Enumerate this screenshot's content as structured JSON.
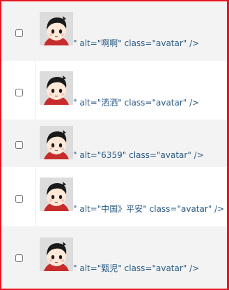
{
  "rows": [
    {
      "checked": false,
      "code_text": "\" alt=\"啊啊\" class=\"avatar\" />"
    },
    {
      "checked": false,
      "code_text": "\" alt=\"洒洒\" class=\"avatar\" />"
    },
    {
      "checked": false,
      "code_text": "\" alt=\"6359\" class=\"avatar\" />"
    },
    {
      "checked": false,
      "code_text": "\" alt=\"中国》平安\" class=\"avatar\" />"
    },
    {
      "checked": false,
      "code_text": "\" alt=\"甄児\" class=\"avatar\" />"
    }
  ],
  "colors": {
    "frame_border": "#e8141e",
    "row_alt_bg": "#f3f3f3",
    "code_text": "#2b5b85"
  },
  "icons": {
    "avatar": "cartoon-avatar-icon",
    "checkbox": "checkbox-icon"
  }
}
